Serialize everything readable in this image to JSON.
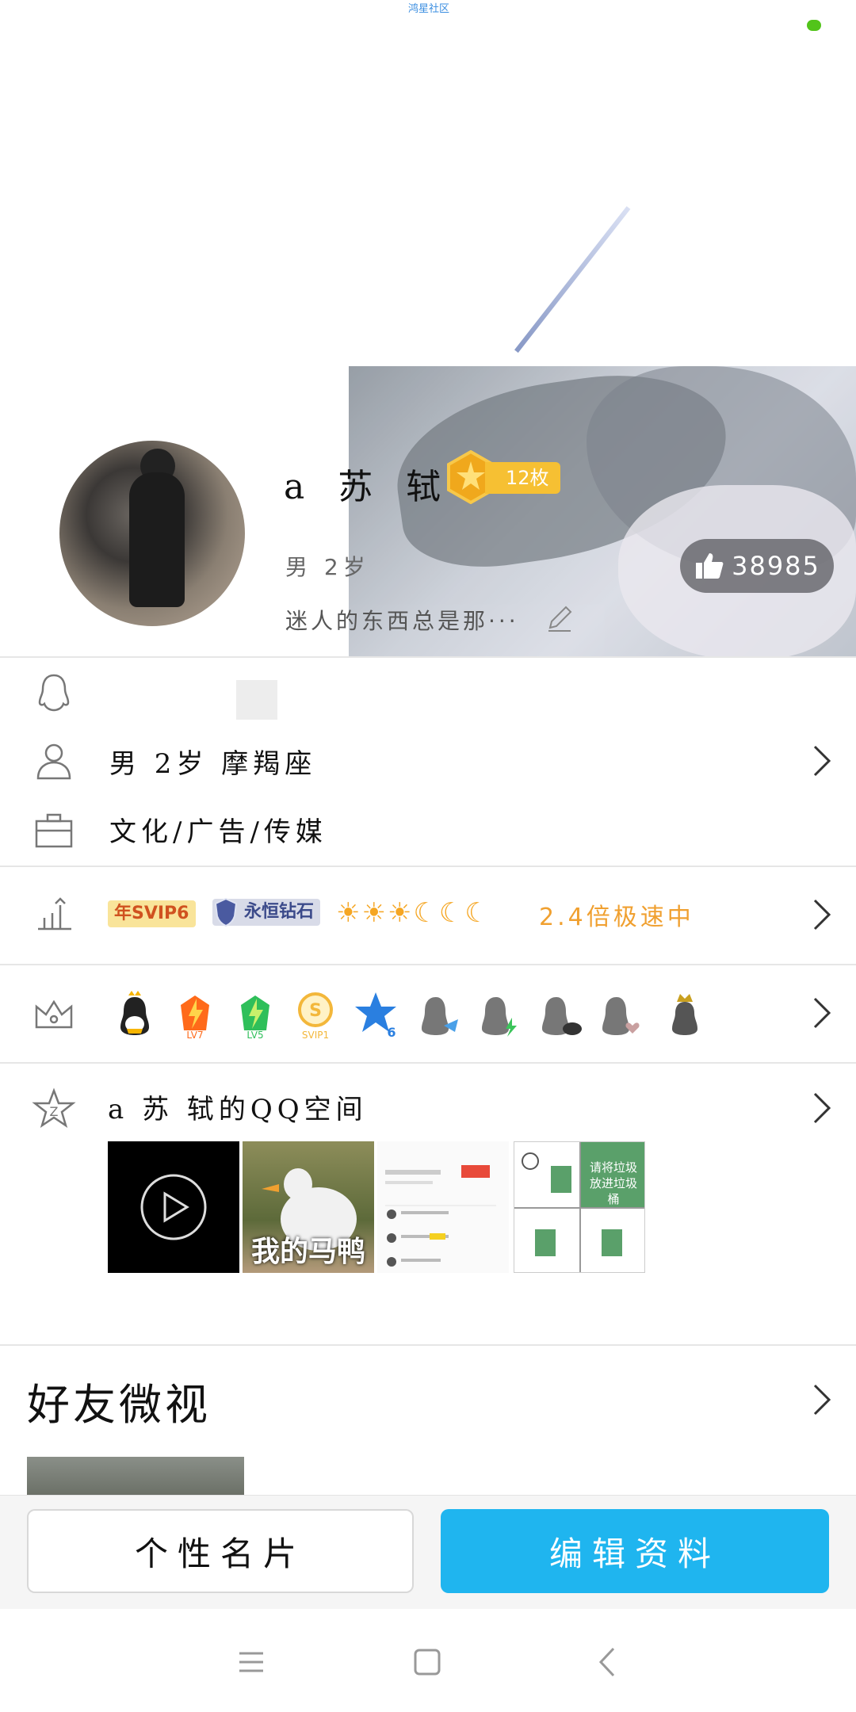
{
  "status": {
    "top_label": "鸿星社区"
  },
  "profile": {
    "nickname": "a 苏 轼",
    "medal_count": "12枚",
    "gender_age": "男 2岁",
    "signature": "迷人的东西总是那···",
    "likes": "38985"
  },
  "info": {
    "basic": "男   2岁   摩羯座",
    "occupation": "文化/广告/传媒"
  },
  "level_row": {
    "svip_badge": "年SVIP6",
    "diamond_badge": "永恒钻石",
    "suns": "☀☀☀☾☾☾",
    "speed": "2.4倍极速中"
  },
  "vip_icons": [
    {
      "label": "",
      "color": "#222"
    },
    {
      "label": "LV7",
      "color": "#ff6a1a"
    },
    {
      "label": "LV5",
      "color": "#2fbf5a"
    },
    {
      "label": "SVIP1",
      "color": "#f3b73a"
    },
    {
      "label": "6",
      "color": "#2a7fe0"
    }
  ],
  "qzone": {
    "title": "a 苏 轼的QQ空间",
    "duck_caption": "我的马鸭",
    "comic_text": "请将垃圾放进垃圾桶"
  },
  "friends": {
    "title": "好友微视"
  },
  "actions": {
    "card_button": "个性名片",
    "edit_button": "编辑资料"
  },
  "colors": {
    "accent": "#1fb5ef",
    "speed": "#f0a030",
    "medal": "#f6c033"
  }
}
